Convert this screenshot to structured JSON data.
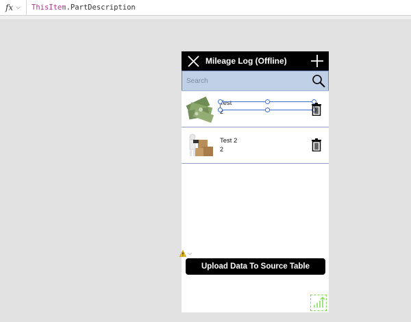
{
  "formula_bar": {
    "fx_label": "fx",
    "expression_keyword": "ThisItem",
    "expression_rest": ".PartDescription"
  },
  "app": {
    "title": "Mileage Log (Offline)",
    "search_placeholder": "Search",
    "items": [
      {
        "name": "Test",
        "value": "2",
        "image": "money-stack-image"
      },
      {
        "name": "Test 2",
        "value": "2",
        "image": "boxes-image"
      }
    ],
    "upload_label": "Upload Data To Source Table"
  },
  "colors": {
    "header_bg": "#000000",
    "search_bg": "#bfd0e6",
    "selection": "#3b6fd1",
    "formula_keyword": "#b5338a"
  },
  "icons": [
    "close-icon",
    "plus-icon",
    "search-icon",
    "trash-icon",
    "warning-icon",
    "chevron-down-icon"
  ]
}
